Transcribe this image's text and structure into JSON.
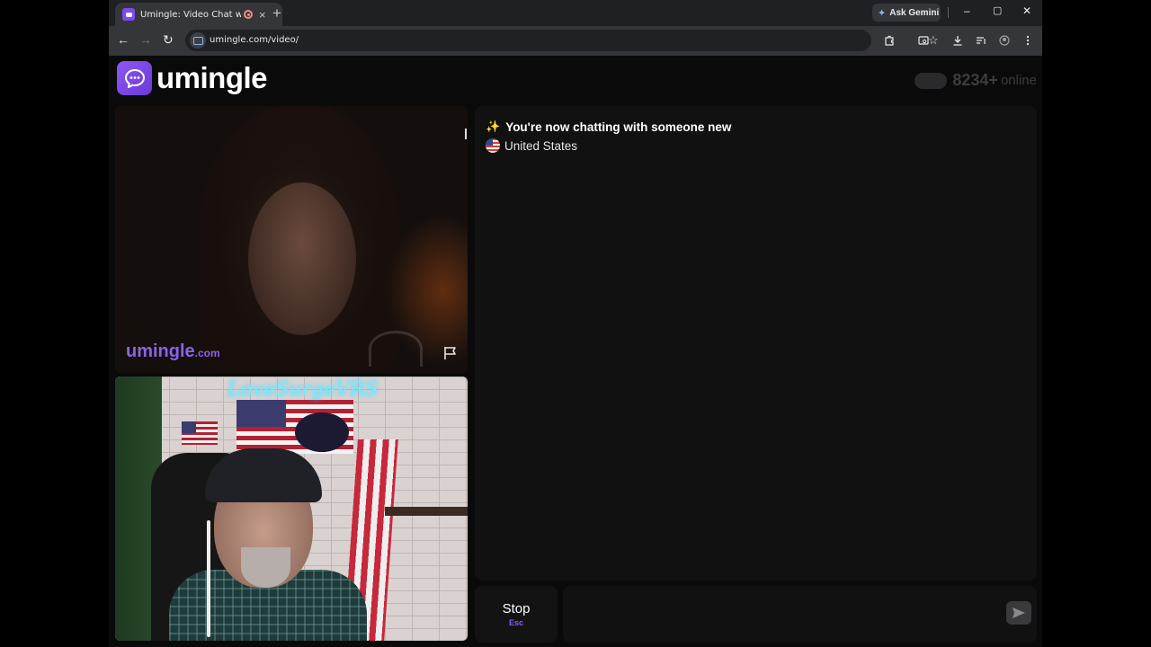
{
  "browser": {
    "tab_title": "Umingle: Video Chat with St",
    "tab_close_icon": "×",
    "new_tab_icon": "+",
    "ask_gemini_label": "Ask Gemini",
    "url": "umingle.com/video/",
    "window_controls": {
      "minimize": "–",
      "maximize": "▢",
      "close": "✕"
    },
    "nav_icons": {
      "back": "←",
      "forward": "→",
      "reload": "↻",
      "bookmark": "☆"
    }
  },
  "site": {
    "logo_text": "umingle",
    "online_count": "8234+",
    "online_label": "online",
    "brand_color": "#7b4ce8"
  },
  "remote_video": {
    "watermark_main": "umingle",
    "watermark_suffix": ".com"
  },
  "self_video": {
    "neon_sign": "LoveSurgeVRS"
  },
  "chat": {
    "status_message": "You're now chatting with someone new",
    "sparkle_icon": "✨",
    "country": "United States"
  },
  "controls": {
    "stop_label": "Stop",
    "stop_shortcut": "Esc",
    "message_placeholder": "",
    "send_icon": "➤"
  }
}
